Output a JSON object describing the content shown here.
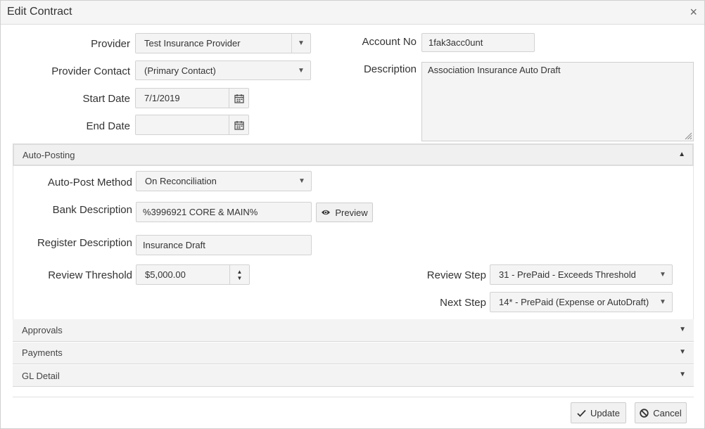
{
  "dialog": {
    "title": "Edit Contract",
    "close": "×"
  },
  "form": {
    "provider_label": "Provider",
    "provider_value": "Test Insurance Provider",
    "provider_contact_label": "Provider Contact",
    "provider_contact_value": "(Primary Contact)",
    "start_date_label": "Start Date",
    "start_date_value": "7/1/2019",
    "end_date_label": "End Date",
    "end_date_value": "",
    "account_no_label": "Account No",
    "account_no_value": "1fak3acc0unt",
    "description_label": "Description",
    "description_value": "Association Insurance Auto Draft"
  },
  "autoposting": {
    "section_title": "Auto-Posting",
    "expanded": true,
    "method_label": "Auto-Post Method",
    "method_value": "On Reconciliation",
    "bank_desc_label": "Bank Description",
    "bank_desc_value": "%3996921 CORE & MAIN%",
    "preview_label": "Preview",
    "register_desc_label": "Register Description",
    "register_desc_value": "Insurance Draft",
    "threshold_label": "Review Threshold",
    "threshold_value": "$5,000.00",
    "review_step_label": "Review Step",
    "review_step_value": "31 - PrePaid - Exceeds Threshold",
    "next_step_label": "Next Step",
    "next_step_value": "14* - PrePaid (Expense or AutoDraft)"
  },
  "sections": [
    {
      "title": "Approvals",
      "expanded": false
    },
    {
      "title": "Payments",
      "expanded": false
    },
    {
      "title": "GL Detail",
      "expanded": false
    }
  ],
  "footer": {
    "update_label": "Update",
    "cancel_label": "Cancel"
  },
  "icons": {
    "calendar": "calendar-icon",
    "eye": "eye-icon",
    "check": "check-icon",
    "ban": "ban-icon",
    "caret_down": "caret-down-icon",
    "caret_up": "caret-up-icon",
    "resize": "resize-grip-icon"
  }
}
